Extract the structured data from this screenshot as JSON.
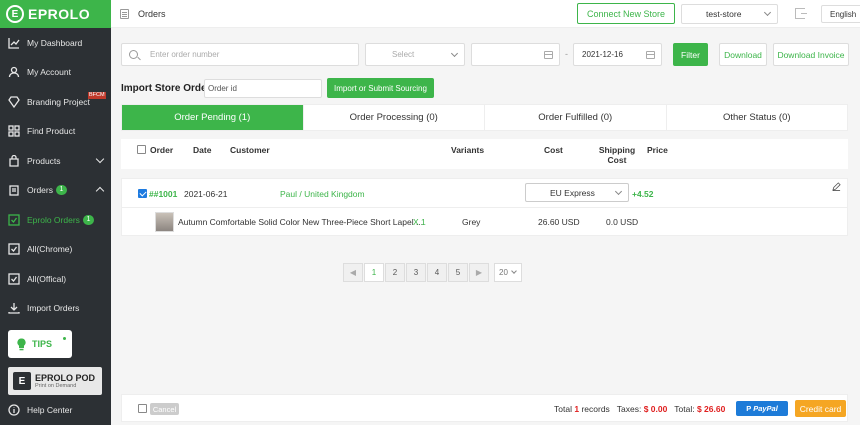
{
  "app": {
    "logo_text": "EPROLO"
  },
  "sidebar": {
    "items": [
      {
        "label": "My Dashboard",
        "icon": "chart-line-icon"
      },
      {
        "label": "My Account",
        "icon": "user-icon"
      },
      {
        "label": "Branding Project",
        "icon": "diamond-icon",
        "badge": "BFCM"
      },
      {
        "label": "Find Product",
        "icon": "grid-icon"
      },
      {
        "label": "Products",
        "icon": "bag-icon"
      },
      {
        "label": "Orders",
        "icon": "clipboard-icon",
        "badge": "1"
      },
      {
        "label": "Eprolo Orders",
        "icon": "check-square-icon",
        "badge": "1"
      },
      {
        "label": "All(Chrome)",
        "icon": "check-square-icon"
      },
      {
        "label": "All(Offical)",
        "icon": "check-square-icon"
      },
      {
        "label": "Import Orders",
        "icon": "download-icon"
      },
      {
        "label": "Help Center",
        "icon": "info-icon"
      }
    ],
    "tips_label": "TIPS",
    "pod_title": "EPROLO POD",
    "pod_subtitle": "Print on Demand"
  },
  "header": {
    "title": "Orders",
    "connect_button": "Connect New Store",
    "store": "test-store",
    "language": "English"
  },
  "filters": {
    "order_placeholder": "Enter order number",
    "select_placeholder": "Select",
    "date_from": "",
    "date_to": "2021-12-16",
    "filter_button": "Filter",
    "download_button": "Download",
    "download_invoice_button": "Download Invoice"
  },
  "import": {
    "label": "Import Store Order:",
    "placeholder": "Order id",
    "button": "Import or Submit Sourcing"
  },
  "tabs": [
    "Order Pending (1)",
    "Order Processing (0)",
    "Order Fulfilled (0)",
    "Other Status (0)"
  ],
  "table": {
    "headers": {
      "order": "Order",
      "date": "Date",
      "customer": "Customer",
      "variants": "Variants",
      "cost": "Cost",
      "shipping_cost": "Shipping Cost",
      "price": "Price"
    },
    "order": {
      "id": "##1001",
      "date": "2021-06-21",
      "customer": "Paul  / United Kingdom",
      "shipping_method": "EU Express",
      "price": "+4.52"
    },
    "item": {
      "title": "Autumn Comfortable Solid Color New Three-Piece Short Lapel ...",
      "quantity": "X 1",
      "variant": "Grey",
      "cost": "26.60 USD",
      "shipping_cost": "0.0 USD"
    }
  },
  "pagination": {
    "pages": [
      "1",
      "2",
      "3",
      "4",
      "5"
    ],
    "prev": "◀",
    "next": "▶",
    "page_size": "20"
  },
  "footer": {
    "cancel_button": "Cancel",
    "total_prefix": "Total",
    "total_count": "1",
    "records_label": "records",
    "taxes_label": "Taxes:",
    "taxes_value": "$ 0.00",
    "total_label": "Total:",
    "total_value": "$ 26.60",
    "paypal_button": "PayPal",
    "credit_button": "Credit card"
  },
  "colors": {
    "brand": "#3db54a",
    "sidebar": "#2c3034",
    "danger": "#e02020",
    "paypal": "#1d7bd8",
    "credit": "#f5a623"
  }
}
